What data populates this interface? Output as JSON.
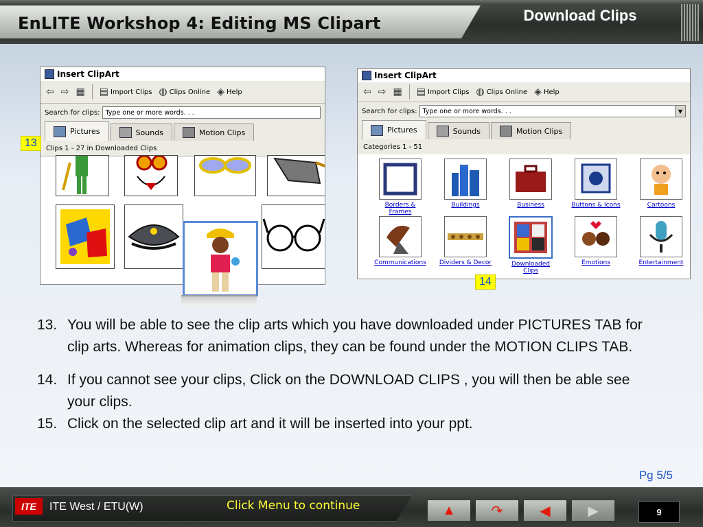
{
  "header": {
    "title": "EnLITE Workshop 4: Editing MS Clipart",
    "section": "Download Clips"
  },
  "left_window": {
    "title": "Insert ClipArt",
    "toolbar": {
      "import": "Import Clips",
      "online": "Clips Online",
      "help": "Help"
    },
    "search_label": "Search for clips:",
    "search_value": "Type one or more words. . .",
    "tabs": [
      "Pictures",
      "Sounds",
      "Motion Clips"
    ],
    "info": "Clips 1 - 27 in Downloaded Clips"
  },
  "right_window": {
    "title": "Insert ClipArt",
    "toolbar": {
      "import": "Import Clips",
      "online": "Clips Online",
      "help": "Help"
    },
    "search_label": "Search for clips:",
    "search_value": "Type one or more words. . .",
    "tabs": [
      "Pictures",
      "Sounds",
      "Motion Clips"
    ],
    "info": "Categories 1 - 51",
    "categories": [
      "Borders & Frames",
      "Buildings",
      "Business",
      "Buttons & Icons",
      "Cartoons",
      "Communications",
      "Dividers & Decor",
      "Downloaded Clips",
      "Emotions",
      "Entertainment"
    ]
  },
  "callouts": {
    "a": "13",
    "b": "14"
  },
  "steps": [
    {
      "num": "13.",
      "text": "You will be able to see the clip arts which you have downloaded under PICTURES TAB for clip arts. Whereas for animation clips, they can be found under the MOTION CLIPS TAB."
    },
    {
      "num": "14.",
      "text": "If you cannot see your clips, Click on the  DOWNLOAD CLIPS , you will then be able  see your clips."
    },
    {
      "num": "15.",
      "text": "Click on the selected clip art and it will be inserted into your ppt."
    }
  ],
  "page_indicator": "Pg  5/5",
  "footer": {
    "logo": "ITE",
    "org": "ITE  West / ETU(W)",
    "cta": "Click Menu to continue",
    "slide_number": "9"
  }
}
